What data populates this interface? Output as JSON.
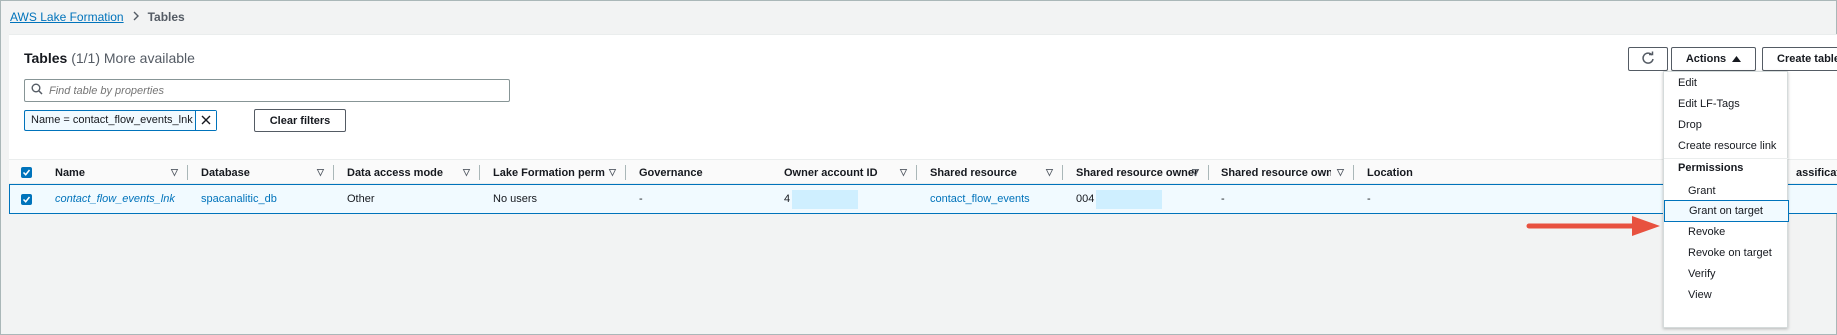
{
  "breadcrumb": {
    "root": "AWS Lake Formation",
    "current": "Tables"
  },
  "panel": {
    "title": "Tables",
    "count": "(1/1) More available"
  },
  "buttons": {
    "actions": "Actions",
    "create": "Create table u",
    "clear_filters": "Clear filters"
  },
  "search": {
    "placeholder": "Find table by properties"
  },
  "filter": {
    "token": "Name = contact_flow_events_lnk"
  },
  "columns": [
    "Name",
    "Database",
    "Data access mode",
    "Lake Formation permiss...",
    "Governance",
    "Owner account ID",
    "Shared resource",
    "Shared resource owner",
    "Shared resource owner ...",
    "Location",
    "assification"
  ],
  "row": {
    "name": "contact_flow_events_lnk",
    "database": "spacanalitic_db",
    "access_mode": "Other",
    "lf_permissions": "No users",
    "governance": "-",
    "owner_account_id": "4",
    "shared_resource": "contact_flow_events",
    "shared_resource_owner": "004",
    "shared_resource_owner_2": "-",
    "location": "-"
  },
  "menu": {
    "edit": "Edit",
    "edit_lf_tags": "Edit LF-Tags",
    "drop": "Drop",
    "create_resource_link": "Create resource link",
    "permissions_header": "Permissions",
    "grant": "Grant",
    "grant_on_target": "Grant on target",
    "revoke": "Revoke",
    "revoke_on_target": "Revoke on target",
    "verify": "Verify",
    "view": "View"
  },
  "colors": {
    "accent": "#0073bb",
    "arrow": "#e8513f",
    "selected_bg": "#f1faff",
    "redaction": "#cfefff"
  }
}
